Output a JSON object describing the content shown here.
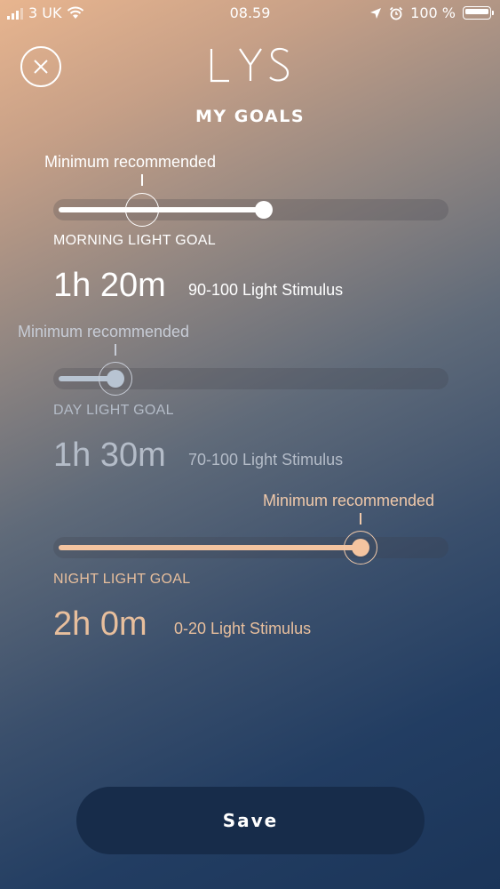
{
  "status_bar": {
    "carrier": "3 UK",
    "time": "08.59",
    "battery": "100 %"
  },
  "header": {
    "logo": "LYS",
    "title": "MY GOALS"
  },
  "goals": [
    {
      "min_label": "Minimum recommended",
      "label": "MORNING LIGHT GOAL",
      "duration": "1h 20m",
      "stimulus": "90-100 Light Stimulus",
      "value_fraction": 0.54,
      "min_fraction": 0.22,
      "color": "#ffffff"
    },
    {
      "min_label": "Minimum recommended",
      "label": "DAY LIGHT GOAL",
      "duration": "1h 30m",
      "stimulus": "70-100 Light Stimulus",
      "value_fraction": 0.14,
      "min_fraction": 0.14,
      "color": "#b8c4d2"
    },
    {
      "min_label": "Minimum recommended",
      "label": "NIGHT LIGHT GOAL",
      "duration": "2h 0m",
      "stimulus": "0-20 Light Stimulus",
      "value_fraction": 0.79,
      "min_fraction": 0.79,
      "color": "#f4c4a0"
    }
  ],
  "actions": {
    "save": "Save"
  }
}
